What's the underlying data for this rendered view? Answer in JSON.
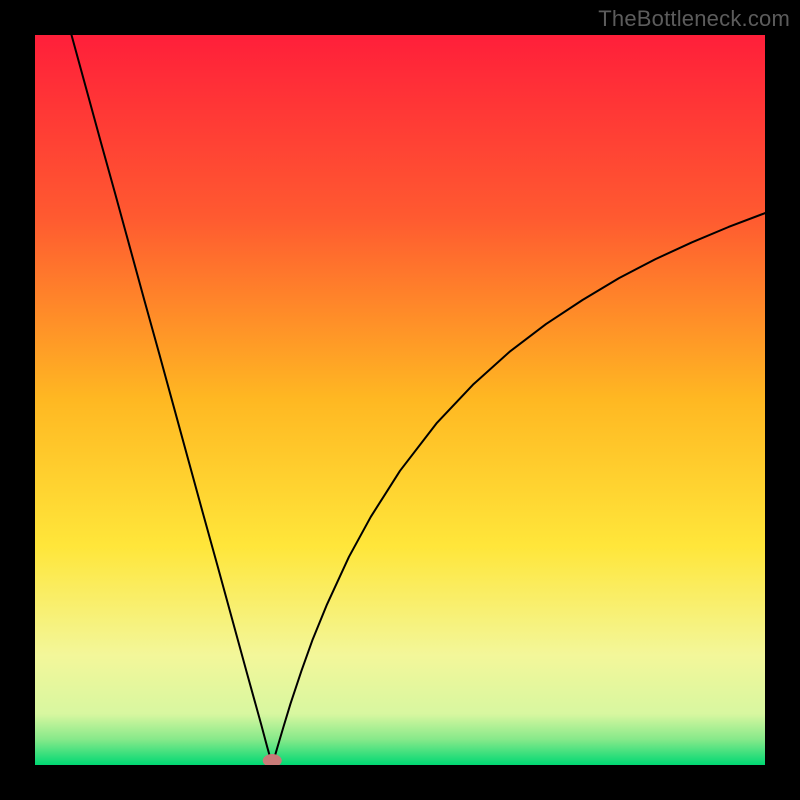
{
  "watermark": "TheBottleneck.com",
  "chart_data": {
    "type": "line",
    "title": "",
    "xlabel": "",
    "ylabel": "",
    "xlim": [
      0,
      100
    ],
    "ylim": [
      0,
      100
    ],
    "grid": false,
    "legend": false,
    "gradient_stops": [
      {
        "offset": 0.0,
        "color": "#ff1f3a"
      },
      {
        "offset": 0.25,
        "color": "#ff5a30"
      },
      {
        "offset": 0.5,
        "color": "#ffb822"
      },
      {
        "offset": 0.7,
        "color": "#ffe63a"
      },
      {
        "offset": 0.85,
        "color": "#f3f79a"
      },
      {
        "offset": 0.93,
        "color": "#d8f7a0"
      },
      {
        "offset": 0.965,
        "color": "#86e98a"
      },
      {
        "offset": 1.0,
        "color": "#00d873"
      }
    ],
    "marker": {
      "x": 32.5,
      "y": 0.6,
      "color": "#c97b78",
      "rx": 1.3,
      "ry": 0.9
    },
    "series": [
      {
        "name": "curve",
        "color": "#000000",
        "stroke_width": 2,
        "x": [
          5.0,
          7.0,
          9.0,
          11.0,
          13.0,
          15.0,
          17.0,
          19.0,
          21.0,
          23.0,
          25.0,
          27.0,
          29.0,
          30.0,
          31.0,
          31.8,
          32.5,
          33.2,
          34.0,
          35.0,
          36.5,
          38.0,
          40.0,
          43.0,
          46.0,
          50.0,
          55.0,
          60.0,
          65.0,
          70.0,
          75.0,
          80.0,
          85.0,
          90.0,
          95.0,
          100.0
        ],
        "y": [
          100.0,
          92.7,
          85.4,
          78.2,
          70.9,
          63.6,
          56.4,
          49.1,
          41.8,
          34.5,
          27.3,
          20.0,
          12.7,
          9.1,
          5.5,
          2.5,
          0.0,
          2.4,
          5.1,
          8.4,
          12.9,
          17.1,
          22.0,
          28.5,
          34.0,
          40.3,
          46.8,
          52.1,
          56.6,
          60.4,
          63.7,
          66.7,
          69.3,
          71.6,
          73.7,
          75.6
        ]
      }
    ]
  }
}
